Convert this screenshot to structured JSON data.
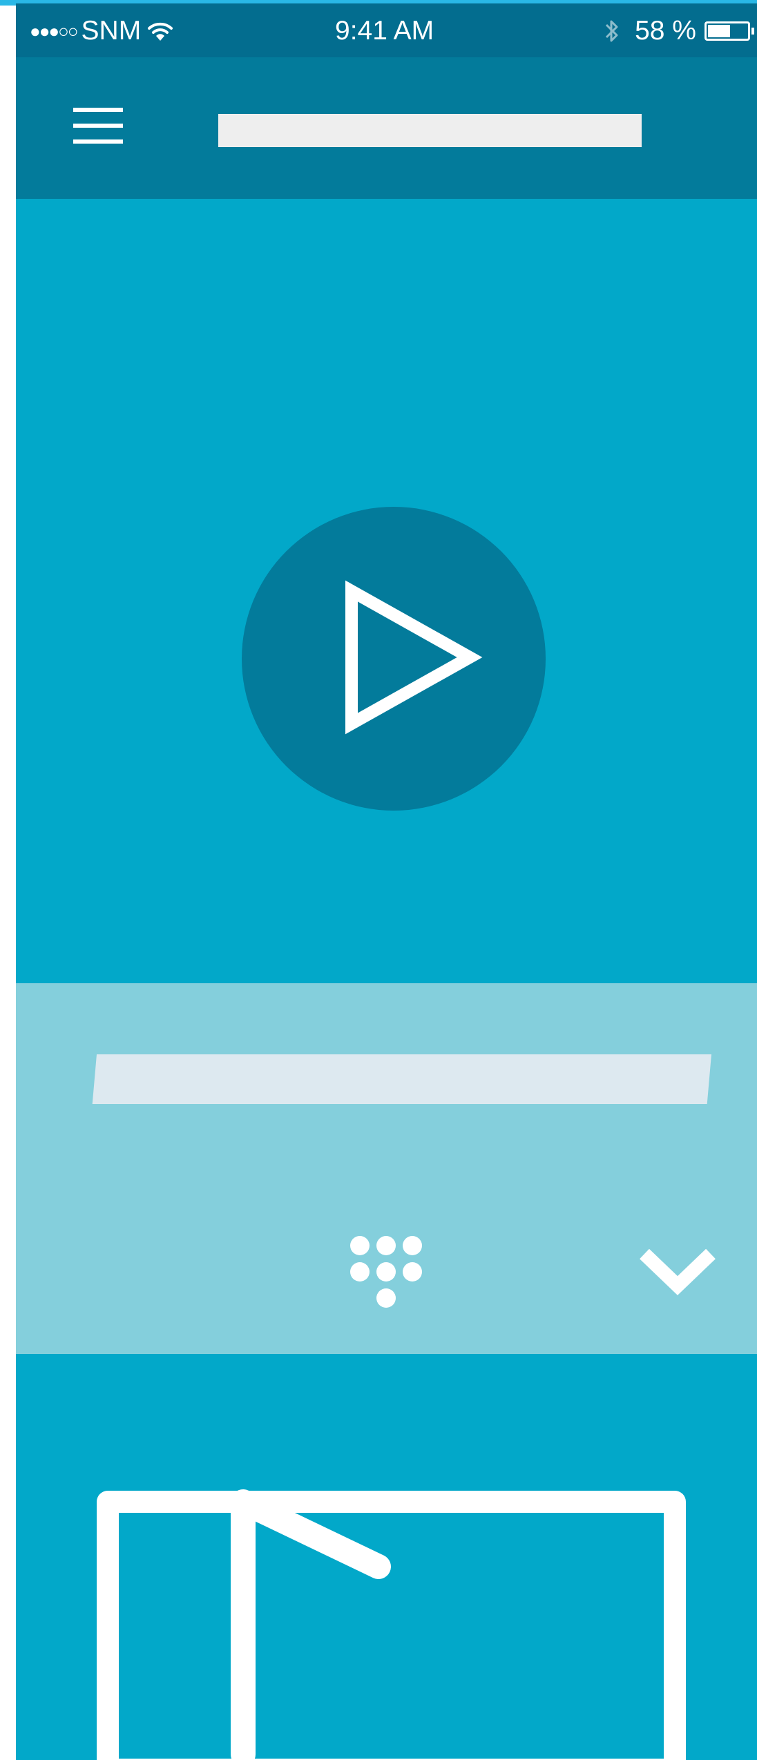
{
  "status_bar": {
    "signal": "●●●○○",
    "carrier": "SNM",
    "wifi_icon": "wifi-icon",
    "time": "9:41 AM",
    "bluetooth_icon": "bluetooth-icon",
    "battery_percent": "58 %",
    "battery_level": 0.58
  },
  "nav_bar": {
    "menu_icon": "hamburger-menu-icon"
  },
  "hero": {
    "play_icon": "play-icon"
  },
  "info_panel": {
    "keypad_icon": "keypad-icon",
    "expand_icon": "chevron-down-icon"
  },
  "lower_section": {
    "play_icon": "play-icon"
  },
  "colors": {
    "primary": "#02a8c9",
    "dark": "#037b9b",
    "status_bar": "#036d8f",
    "panel": "#84cfdc",
    "placeholder": "#eeeeee"
  }
}
